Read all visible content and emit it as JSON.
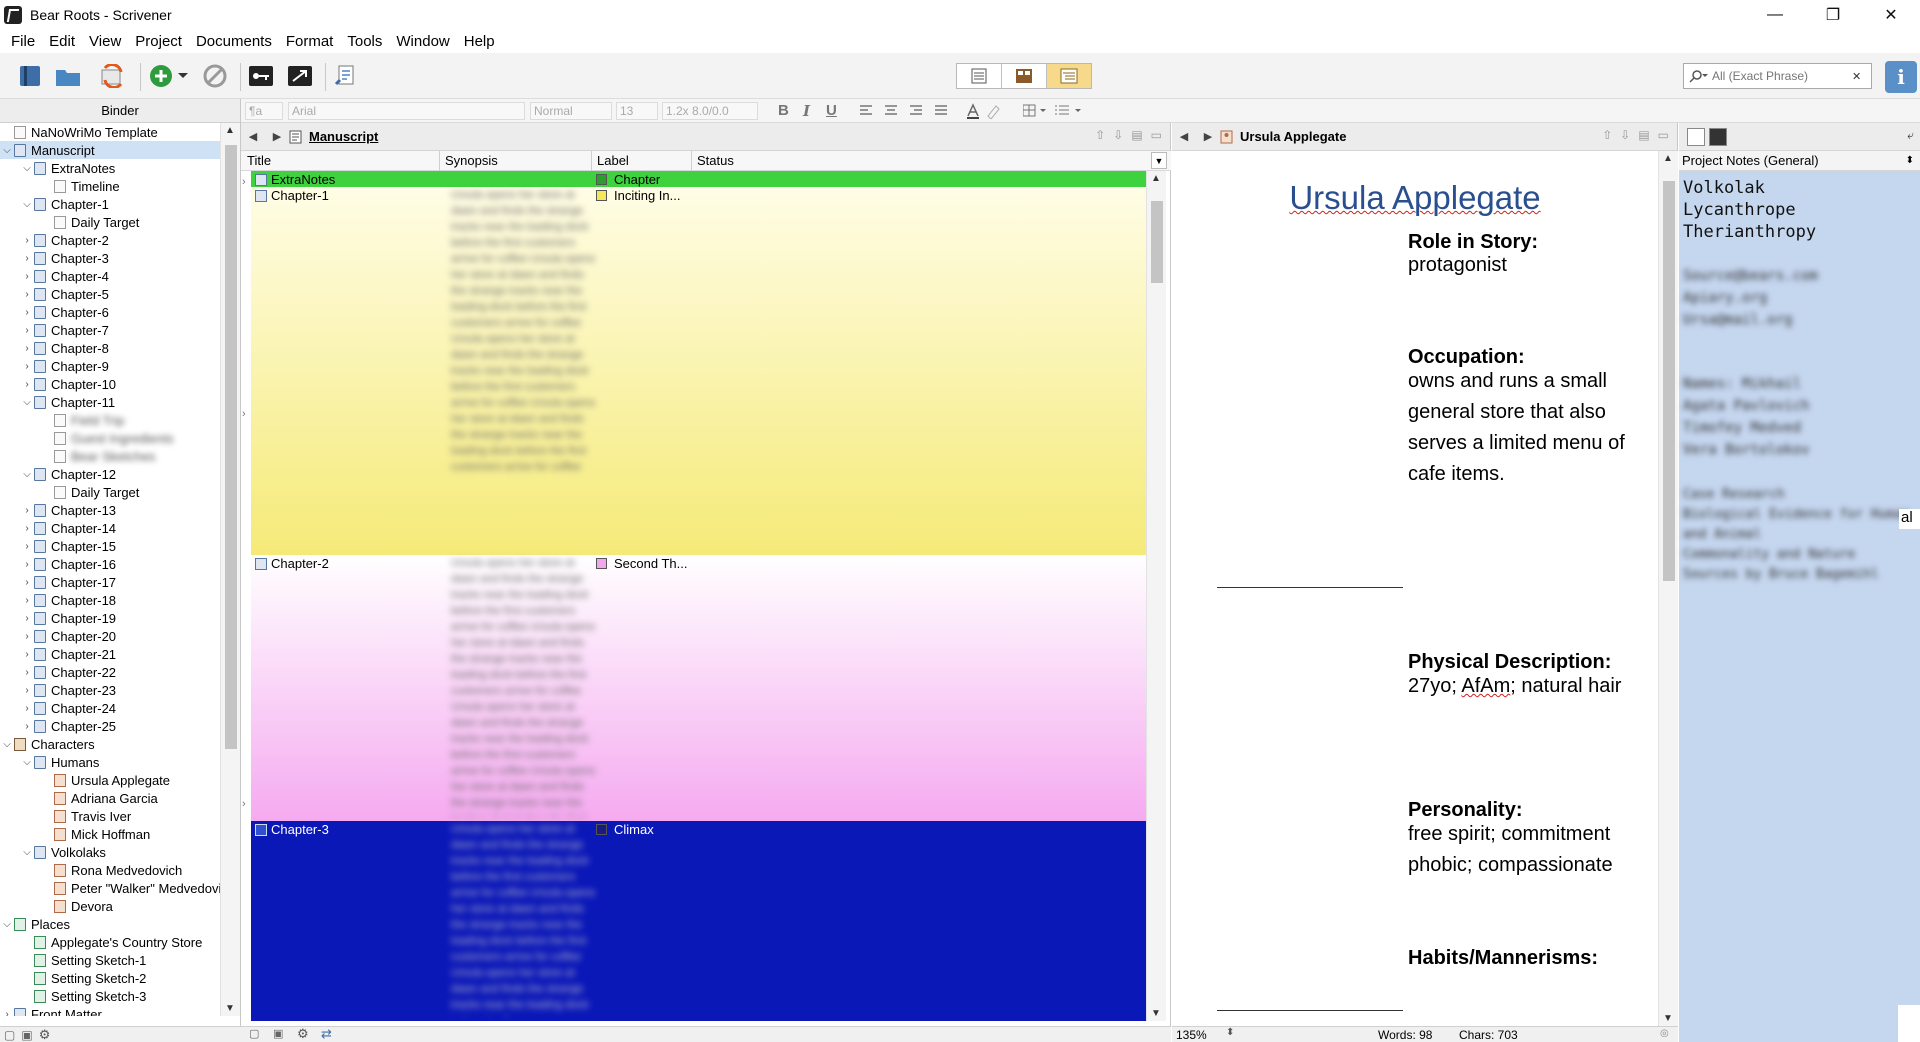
{
  "window": {
    "title": "Bear Roots - Scrivener",
    "controls": {
      "minimize": "—",
      "restore": "❐",
      "close": "✕"
    }
  },
  "menu": [
    "File",
    "Edit",
    "View",
    "Project",
    "Documents",
    "Format",
    "Tools",
    "Window",
    "Help"
  ],
  "toolbar": {
    "search_placeholder": "All (Exact Phrase)",
    "info_label": "i"
  },
  "format_bar": {
    "para_style": "¶a",
    "font": "Arial",
    "typeface": "Normal",
    "size": "13",
    "spacing": "1.2x 8.0/0.0",
    "bold": "B",
    "italic": "I",
    "underline": "U"
  },
  "binder": {
    "header": "Binder",
    "items": [
      {
        "label": "NaNoWriMo Template",
        "level": 0,
        "arrow": "",
        "icon": "ico-doc",
        "selected": false,
        "blur": false
      },
      {
        "label": "Manuscript",
        "level": 0,
        "arrow": "⌵",
        "icon": "ico-folder",
        "selected": true,
        "blur": false
      },
      {
        "label": "ExtraNotes",
        "level": 1,
        "arrow": "⌵",
        "icon": "ico-folder",
        "selected": false,
        "blur": false
      },
      {
        "label": "Timeline",
        "level": 2,
        "arrow": "",
        "icon": "ico-doc",
        "selected": false,
        "blur": false
      },
      {
        "label": "Chapter-1",
        "level": 1,
        "arrow": "⌵",
        "icon": "ico-folder",
        "selected": false,
        "blur": false
      },
      {
        "label": "Daily Target",
        "level": 2,
        "arrow": "",
        "icon": "ico-doc",
        "selected": false,
        "blur": false
      },
      {
        "label": "Chapter-2",
        "level": 1,
        "arrow": "›",
        "icon": "ico-folder",
        "selected": false,
        "blur": false
      },
      {
        "label": "Chapter-3",
        "level": 1,
        "arrow": "›",
        "icon": "ico-folder",
        "selected": false,
        "blur": false
      },
      {
        "label": "Chapter-4",
        "level": 1,
        "arrow": "›",
        "icon": "ico-folder",
        "selected": false,
        "blur": false
      },
      {
        "label": "Chapter-5",
        "level": 1,
        "arrow": "›",
        "icon": "ico-folder",
        "selected": false,
        "blur": false
      },
      {
        "label": "Chapter-6",
        "level": 1,
        "arrow": "›",
        "icon": "ico-folder",
        "selected": false,
        "blur": false
      },
      {
        "label": "Chapter-7",
        "level": 1,
        "arrow": "›",
        "icon": "ico-folder",
        "selected": false,
        "blur": false
      },
      {
        "label": "Chapter-8",
        "level": 1,
        "arrow": "›",
        "icon": "ico-folder",
        "selected": false,
        "blur": false
      },
      {
        "label": "Chapter-9",
        "level": 1,
        "arrow": "›",
        "icon": "ico-folder",
        "selected": false,
        "blur": false
      },
      {
        "label": "Chapter-10",
        "level": 1,
        "arrow": "›",
        "icon": "ico-folder",
        "selected": false,
        "blur": false
      },
      {
        "label": "Chapter-11",
        "level": 1,
        "arrow": "⌵",
        "icon": "ico-folder",
        "selected": false,
        "blur": false
      },
      {
        "label": "Field Trip",
        "level": 2,
        "arrow": "",
        "icon": "ico-doc",
        "selected": false,
        "blur": true
      },
      {
        "label": "Guest Ingredients",
        "level": 2,
        "arrow": "",
        "icon": "ico-doc",
        "selected": false,
        "blur": true
      },
      {
        "label": "Bear Sketches",
        "level": 2,
        "arrow": "",
        "icon": "ico-doc",
        "selected": false,
        "blur": true
      },
      {
        "label": "Chapter-12",
        "level": 1,
        "arrow": "⌵",
        "icon": "ico-folder",
        "selected": false,
        "blur": false
      },
      {
        "label": "Daily Target",
        "level": 2,
        "arrow": "",
        "icon": "ico-doc",
        "selected": false,
        "blur": false
      },
      {
        "label": "Chapter-13",
        "level": 1,
        "arrow": "›",
        "icon": "ico-folder",
        "selected": false,
        "blur": false
      },
      {
        "label": "Chapter-14",
        "level": 1,
        "arrow": "›",
        "icon": "ico-folder",
        "selected": false,
        "blur": false
      },
      {
        "label": "Chapter-15",
        "level": 1,
        "arrow": "›",
        "icon": "ico-folder",
        "selected": false,
        "blur": false
      },
      {
        "label": "Chapter-16",
        "level": 1,
        "arrow": "›",
        "icon": "ico-folder",
        "selected": false,
        "blur": false
      },
      {
        "label": "Chapter-17",
        "level": 1,
        "arrow": "›",
        "icon": "ico-folder",
        "selected": false,
        "blur": false
      },
      {
        "label": "Chapter-18",
        "level": 1,
        "arrow": "›",
        "icon": "ico-folder",
        "selected": false,
        "blur": false
      },
      {
        "label": "Chapter-19",
        "level": 1,
        "arrow": "›",
        "icon": "ico-folder",
        "selected": false,
        "blur": false
      },
      {
        "label": "Chapter-20",
        "level": 1,
        "arrow": "›",
        "icon": "ico-folder",
        "selected": false,
        "blur": false
      },
      {
        "label": "Chapter-21",
        "level": 1,
        "arrow": "›",
        "icon": "ico-folder",
        "selected": false,
        "blur": false
      },
      {
        "label": "Chapter-22",
        "level": 1,
        "arrow": "›",
        "icon": "ico-folder",
        "selected": false,
        "blur": false
      },
      {
        "label": "Chapter-23",
        "level": 1,
        "arrow": "›",
        "icon": "ico-folder",
        "selected": false,
        "blur": false
      },
      {
        "label": "Chapter-24",
        "level": 1,
        "arrow": "›",
        "icon": "ico-folder",
        "selected": false,
        "blur": false
      },
      {
        "label": "Chapter-25",
        "level": 1,
        "arrow": "›",
        "icon": "ico-folder",
        "selected": false,
        "blur": false
      },
      {
        "label": "Characters",
        "level": 0,
        "arrow": "⌵",
        "icon": "ico-folder2",
        "selected": false,
        "blur": false
      },
      {
        "label": "Humans",
        "level": 1,
        "arrow": "⌵",
        "icon": "ico-folder",
        "selected": false,
        "blur": false
      },
      {
        "label": "Ursula Applegate",
        "level": 2,
        "arrow": "",
        "icon": "ico-char",
        "selected": false,
        "blur": false
      },
      {
        "label": "Adriana Garcia",
        "level": 2,
        "arrow": "",
        "icon": "ico-char",
        "selected": false,
        "blur": false
      },
      {
        "label": "Travis Iver",
        "level": 2,
        "arrow": "",
        "icon": "ico-char",
        "selected": false,
        "blur": false
      },
      {
        "label": "Mick Hoffman",
        "level": 2,
        "arrow": "",
        "icon": "ico-char",
        "selected": false,
        "blur": false
      },
      {
        "label": "Volkolaks",
        "level": 1,
        "arrow": "⌵",
        "icon": "ico-folder",
        "selected": false,
        "blur": false
      },
      {
        "label": "Rona Medvedovich",
        "level": 2,
        "arrow": "",
        "icon": "ico-char",
        "selected": false,
        "blur": false
      },
      {
        "label": "Peter \"Walker\" Medvedovich",
        "level": 2,
        "arrow": "",
        "icon": "ico-char",
        "selected": false,
        "blur": false
      },
      {
        "label": "Devora",
        "level": 2,
        "arrow": "",
        "icon": "ico-char",
        "selected": false,
        "blur": false
      },
      {
        "label": "Places",
        "level": 0,
        "arrow": "⌵",
        "icon": "ico-place",
        "selected": false,
        "blur": false
      },
      {
        "label": "Applegate's Country Store",
        "level": 1,
        "arrow": "",
        "icon": "ico-place",
        "selected": false,
        "blur": false
      },
      {
        "label": "Setting Sketch-1",
        "level": 1,
        "arrow": "",
        "icon": "ico-place",
        "selected": false,
        "blur": false
      },
      {
        "label": "Setting Sketch-2",
        "level": 1,
        "arrow": "",
        "icon": "ico-place",
        "selected": false,
        "blur": false
      },
      {
        "label": "Setting Sketch-3",
        "level": 1,
        "arrow": "",
        "icon": "ico-place",
        "selected": false,
        "blur": false
      },
      {
        "label": "Front Matter",
        "level": 0,
        "arrow": "›",
        "icon": "ico-folder",
        "selected": false,
        "blur": false
      }
    ]
  },
  "outliner": {
    "title": "Manuscript",
    "columns": {
      "title": "Title",
      "synopsis": "Synopsis",
      "label": "Label",
      "status": "Status"
    },
    "rows": [
      {
        "title": "ExtraNotes",
        "label": "Chapter",
        "label_color": "#2e9b2e",
        "bg": "#3ed23e"
      },
      {
        "title": "Chapter-1",
        "label": "Inciting In...",
        "label_color": "#f2e85a",
        "bg": "yellow-grad"
      },
      {
        "title": "Chapter-2",
        "label": "Second Th...",
        "label_color": "#f2a8ec",
        "bg": "pink-grad"
      },
      {
        "title": "Chapter-3",
        "label": "Climax",
        "label_color": "#1a1a80",
        "bg": "#0b18b8"
      }
    ],
    "blurred_synopsis": "Ursula opens her store at dawn and finds the strange tracks near the loading dock before the first customers arrive for coffee"
  },
  "editor": {
    "title": "Ursula Applegate",
    "fields": [
      {
        "heading": "Role in Story:",
        "value": "protagonist"
      },
      {
        "heading": "Occupation:",
        "value": "owns and runs a small general store that also serves a limited menu of cafe items."
      },
      {
        "heading": "Physical Description:",
        "value": "27yo; AfAm; natural hair"
      },
      {
        "heading": "Personality:",
        "value": "free spirit; commitment phobic; compassionate"
      },
      {
        "heading": "Habits/Mannerisms:",
        "value": ""
      }
    ],
    "zoom": "135%",
    "words": "Words: 98",
    "chars": "Chars: 703"
  },
  "inspector": {
    "subheader": "Project Notes (General)",
    "notes_lines": [
      "Volkolak",
      "Lycanthrope",
      "Therianthropy"
    ],
    "overflow_glyph": "al"
  }
}
